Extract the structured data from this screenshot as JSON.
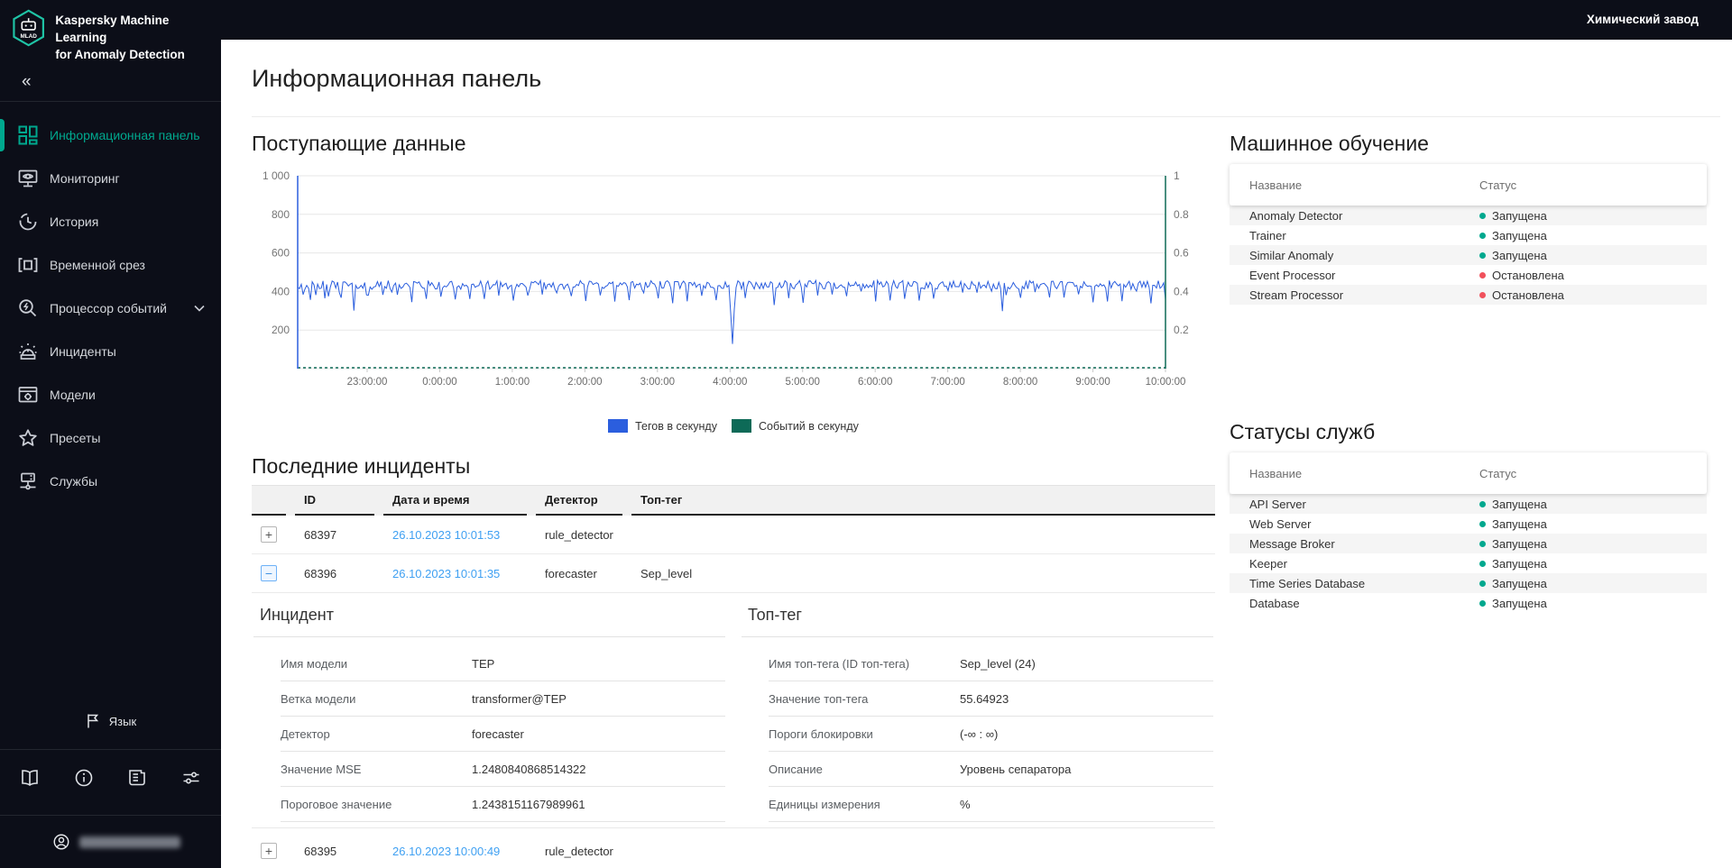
{
  "app": {
    "logo_text": "MLAD",
    "title_line1": "Kaspersky Machine Learning",
    "title_line2": "for Anomaly Detection",
    "org": "Химический завод"
  },
  "sidebar": {
    "collapse": "«",
    "items": [
      {
        "label": "Информационная панель",
        "icon": "dashboard-icon",
        "state": "active"
      },
      {
        "label": "Мониторинг",
        "icon": "monitoring-icon",
        "state": ""
      },
      {
        "label": "История",
        "icon": "history-icon",
        "state": ""
      },
      {
        "label": "Временной срез",
        "icon": "time-slice-icon",
        "state": ""
      },
      {
        "label": "Процессор событий",
        "icon": "event-processor-icon",
        "state": "",
        "has_chevron": true
      },
      {
        "label": "Инциденты",
        "icon": "incidents-icon",
        "state": ""
      },
      {
        "label": "Модели",
        "icon": "models-icon",
        "state": ""
      },
      {
        "label": "Пресеты",
        "icon": "presets-icon",
        "state": ""
      },
      {
        "label": "Службы",
        "icon": "services-icon",
        "state": ""
      }
    ],
    "language_label": "Язык"
  },
  "page": {
    "title": "Информационная панель"
  },
  "chart_data": {
    "type": "line",
    "title": "Поступающие данные",
    "x_ticks": [
      "23:00:00",
      "0:00:00",
      "1:00:00",
      "2:00:00",
      "3:00:00",
      "4:00:00",
      "5:00:00",
      "6:00:00",
      "7:00:00",
      "8:00:00",
      "9:00:00",
      "10:00:00"
    ],
    "left_axis": {
      "range": [
        0,
        1000
      ],
      "tick_values": [
        1000,
        800,
        600,
        400,
        200
      ],
      "tick_labels": [
        "1 000",
        "800",
        "600",
        "400",
        "200"
      ]
    },
    "right_axis": {
      "range": [
        0,
        1
      ],
      "tick_values": [
        1,
        0.8,
        0.6,
        0.4,
        0.2
      ],
      "tick_labels": [
        "1",
        "0.8",
        "0.6",
        "0.4",
        "0.2"
      ]
    },
    "grid": true,
    "legend_position": "bottom",
    "series": [
      {
        "name": "Тегов в секунду",
        "color": "#2b5ede",
        "axis": "left",
        "shape": {
          "type": "noisy-line",
          "points": 480,
          "seed": 42,
          "baseline": 434,
          "noise": 46,
          "dip_every": 8,
          "dip_min": 35,
          "dip_max": 95,
          "major_dips": [
            {
              "x_frac": 0.5,
              "value": 128
            },
            {
              "x_frac": 0.812,
              "value": 298
            }
          ],
          "description": "около 434 тегов/с с частыми короткими провалами до 300–390; глубокий провал до ~130 в 4:00:00 и до ~300 около 7:45:00"
        }
      },
      {
        "name": "Событий в секунду",
        "color": "#0d6a57",
        "axis": "right",
        "shape": {
          "type": "constant",
          "value": 0
        }
      }
    ]
  },
  "ml_table": {
    "title": "Машинное обучение",
    "columns": {
      "name": "Название",
      "status": "Статус"
    },
    "rows": [
      {
        "name": "Anomaly Detector",
        "status": "Запущена",
        "state": "running"
      },
      {
        "name": "Trainer",
        "status": "Запущена",
        "state": "running"
      },
      {
        "name": "Similar Anomaly",
        "status": "Запущена",
        "state": "running"
      },
      {
        "name": "Event Processor",
        "status": "Остановлена",
        "state": "stopped"
      },
      {
        "name": "Stream Processor",
        "status": "Остановлена",
        "state": "stopped"
      }
    ]
  },
  "services_table": {
    "title": "Статусы служб",
    "columns": {
      "name": "Название",
      "status": "Статус"
    },
    "rows": [
      {
        "name": "API Server",
        "status": "Запущена",
        "state": "running"
      },
      {
        "name": "Web Server",
        "status": "Запущена",
        "state": "running"
      },
      {
        "name": "Message Broker",
        "status": "Запущена",
        "state": "running"
      },
      {
        "name": "Keeper",
        "status": "Запущена",
        "state": "running"
      },
      {
        "name": "Time Series Database",
        "status": "Запущена",
        "state": "running"
      },
      {
        "name": "Database",
        "status": "Запущена",
        "state": "running"
      }
    ]
  },
  "incidents": {
    "title": "Последние инциденты",
    "columns": {
      "id": "ID",
      "datetime": "Дата и время",
      "detector": "Детектор",
      "top_tag": "Топ-тег"
    },
    "rows": [
      {
        "expand": "+",
        "id": "68397",
        "datetime": "26.10.2023 10:01:53",
        "detector": "rule_detector",
        "top_tag": ""
      },
      {
        "expand": "−",
        "id": "68396",
        "datetime": "26.10.2023 10:01:35",
        "detector": "forecaster",
        "top_tag": "Sep_level"
      },
      {
        "expand": "+",
        "id": "68395",
        "datetime": "26.10.2023 10:00:49",
        "detector": "rule_detector",
        "top_tag": ""
      }
    ],
    "incident_panel": {
      "title": "Инцидент",
      "fields": [
        {
          "label": "Имя модели",
          "value": "TEP"
        },
        {
          "label": "Ветка модели",
          "value": "transformer@TEP"
        },
        {
          "label": "Детектор",
          "value": "forecaster"
        },
        {
          "label": "Значение MSE",
          "value": "1.2480840868514322"
        },
        {
          "label": "Пороговое значение",
          "value": "1.2438151167989961"
        }
      ]
    },
    "top_tag_panel": {
      "title": "Топ-тег",
      "fields": [
        {
          "label": "Имя топ-тега (ID топ-тега)",
          "value": "Sep_level (24)"
        },
        {
          "label": "Значение топ-тега",
          "value": "55.64923"
        },
        {
          "label": "Пороги блокировки",
          "value": "(-∞ : ∞)"
        },
        {
          "label": "Описание",
          "value": "Уровень сепаратора"
        },
        {
          "label": "Единицы измерения",
          "value": "%"
        }
      ]
    }
  },
  "colors": {
    "accent_teal": "#00a88e",
    "status_running": "#00a88e",
    "status_stopped": "#f0515c",
    "link_blue": "#3fa0f2",
    "chart_blue": "#2b5ede",
    "chart_green": "#0d6a57",
    "dark_bg": "#0c0e18"
  }
}
